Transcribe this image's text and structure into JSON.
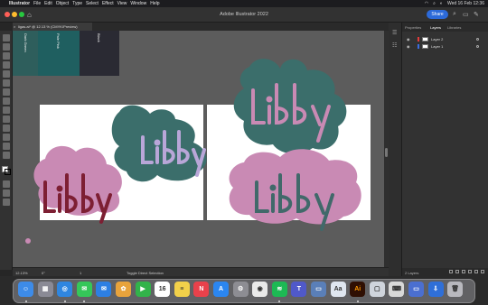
{
  "menubar": {
    "items": [
      "Illustrator",
      "File",
      "Edit",
      "Object",
      "Type",
      "Select",
      "Effect",
      "View",
      "Window",
      "Help"
    ],
    "datetime": "Wed 16 Feb  12:36"
  },
  "app": {
    "title": "Adobe Illustrator 2022",
    "share_label": "Share"
  },
  "document": {
    "tab_label": "ligas.ai* @ 12.13 % (CMYK/Preview)"
  },
  "swatches": [
    {
      "label": "Dark Green",
      "color": "#2e5e5c"
    },
    {
      "label": "Pale Pink",
      "color": "#1f5f60"
    },
    {
      "label": "Black",
      "color": "#2a2a33"
    }
  ],
  "artwork": {
    "text": "Libby",
    "colors": {
      "teal": "#3b6e6b",
      "pink": "#c98ab4",
      "lilac": "#b9a6d8",
      "maroon": "#7d1f33",
      "slate": "#41696a"
    }
  },
  "statusbar": {
    "zoom": "12.13%",
    "rotation": "0°",
    "artboard": "1",
    "tool": "Toggle Direct Selection"
  },
  "panel": {
    "tabs": [
      "Properties",
      "Layers",
      "Libraries"
    ],
    "active_tab": "Layers",
    "layers": [
      {
        "name": "Layer 2",
        "color": "#e23b3b"
      },
      {
        "name": "Layer 1",
        "color": "#3b6ee2"
      }
    ],
    "footer_count": "2 Layers"
  },
  "dock": {
    "apps": [
      {
        "name": "Finder",
        "color": "#3d8be8",
        "glyph": "☺"
      },
      {
        "name": "Launchpad",
        "color": "#8a8a95",
        "glyph": "▦"
      },
      {
        "name": "Safari",
        "color": "#2f86e0",
        "glyph": "◎"
      },
      {
        "name": "Messages",
        "color": "#35c759",
        "glyph": "✉"
      },
      {
        "name": "Mail",
        "color": "#2d7fe3",
        "glyph": "✉"
      },
      {
        "name": "Photos",
        "color": "#e8a33c",
        "glyph": "✿"
      },
      {
        "name": "FaceTime",
        "color": "#32b34a",
        "glyph": "▶"
      },
      {
        "name": "Calendar",
        "color": "#ffffff",
        "glyph": "16"
      },
      {
        "name": "Notes",
        "color": "#f2d04a",
        "glyph": "≡"
      },
      {
        "name": "News",
        "color": "#e9414b",
        "glyph": "N"
      },
      {
        "name": "App Store",
        "color": "#2b86f0",
        "glyph": "A"
      },
      {
        "name": "System Preferences",
        "color": "#8d8d93",
        "glyph": "⚙"
      },
      {
        "name": "Chrome",
        "color": "#e9e9e9",
        "glyph": "◉"
      },
      {
        "name": "Spotify",
        "color": "#1db954",
        "glyph": "≋"
      },
      {
        "name": "Teams",
        "color": "#5059c9",
        "glyph": "T"
      },
      {
        "name": "Preview",
        "color": "#5a7fb8",
        "glyph": "▭"
      },
      {
        "name": "Fonts",
        "color": "#dfe6f0",
        "glyph": "Aa"
      },
      {
        "name": "Illustrator",
        "color": "#2f0f03",
        "glyph": "Ai"
      },
      {
        "name": "Screenshot",
        "color": "#cfd4dc",
        "glyph": "▢"
      },
      {
        "name": "Keyboard",
        "color": "#d8d8d8",
        "glyph": "⌨"
      },
      {
        "name": "Window",
        "color": "#4b6fd0",
        "glyph": "▭"
      },
      {
        "name": "Downloads",
        "color": "#2f6fd8",
        "glyph": "⇩"
      },
      {
        "name": "Trash",
        "color": "#b8b8be",
        "glyph": "🗑"
      }
    ]
  }
}
